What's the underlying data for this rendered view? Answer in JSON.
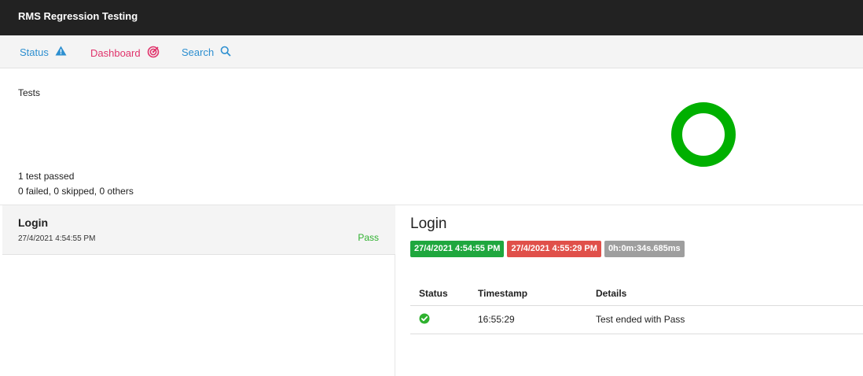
{
  "app": {
    "title": "RMS Regression Testing"
  },
  "nav": {
    "status_label": "Status",
    "dashboard_label": "Dashboard",
    "search_label": "Search"
  },
  "summary": {
    "title": "Tests",
    "passed_count": "1",
    "passed_text": " test passed",
    "failed_count": "0",
    "failed_text": " failed, ",
    "skipped_count": "0",
    "skipped_text": " skipped, ",
    "others_count": "0",
    "others_text": " others",
    "chart": {
      "passed": 1,
      "failed": 0,
      "skipped": 0,
      "others": 0,
      "pass_color": "#00b000"
    }
  },
  "tests": [
    {
      "name": "Login",
      "time": "27/4/2021 4:54:55 PM",
      "status": "Pass"
    }
  ],
  "detail": {
    "title": "Login",
    "start_time": "27/4/2021 4:54:55 PM",
    "end_time": "27/4/2021 4:55:29 PM",
    "duration": "0h:0m:34s.685ms",
    "columns": [
      "Status",
      "Timestamp",
      "Details"
    ],
    "logs": [
      {
        "status_icon": "check-circle-icon",
        "timestamp": "16:55:29",
        "details": "Test ended with Pass"
      }
    ]
  },
  "colors": {
    "pass": "#2fb12f",
    "fail": "#e0504a",
    "accent": "#2d8fd0",
    "dashboard": "#e0336b"
  }
}
